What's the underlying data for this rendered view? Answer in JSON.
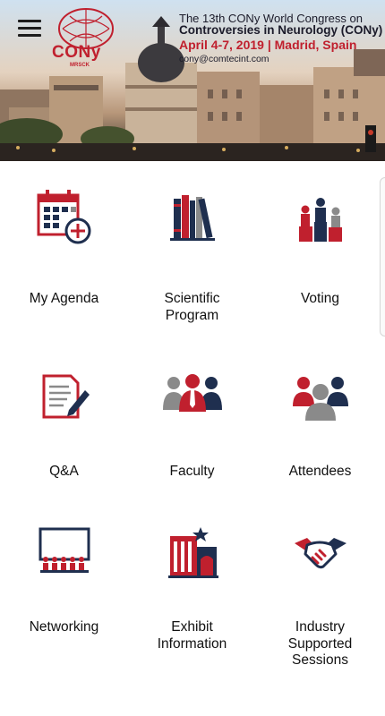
{
  "header": {
    "logo_text": "CONy",
    "logo_sub": "MRSCK",
    "line1": "The 13th CONy World Congress on",
    "line2": "Controversies in Neurology (CONy)",
    "line3": "April 4-7, 2019 | Madrid, Spain",
    "email": "cony@comtecint.com",
    "menu_icon": "hamburger-menu-icon"
  },
  "colors": {
    "accent_red": "#c0202e",
    "navy": "#1f2f4f",
    "grey": "#8a8a8a"
  },
  "tiles": [
    {
      "label": "My Agenda",
      "icon": "calendar-add-icon"
    },
    {
      "label": "Scientific\nProgram",
      "icon": "books-icon"
    },
    {
      "label": "Voting",
      "icon": "podium-icon"
    },
    {
      "label": "Q&A",
      "icon": "document-pen-icon"
    },
    {
      "label": "Faculty",
      "icon": "faculty-group-icon"
    },
    {
      "label": "Attendees",
      "icon": "attendees-group-icon"
    },
    {
      "label": "Networking",
      "icon": "presentation-audience-icon"
    },
    {
      "label": "Exhibit\nInformation",
      "icon": "exhibit-booth-icon"
    },
    {
      "label": "Industry\nSupported\nSessions",
      "icon": "handshake-icon"
    }
  ]
}
